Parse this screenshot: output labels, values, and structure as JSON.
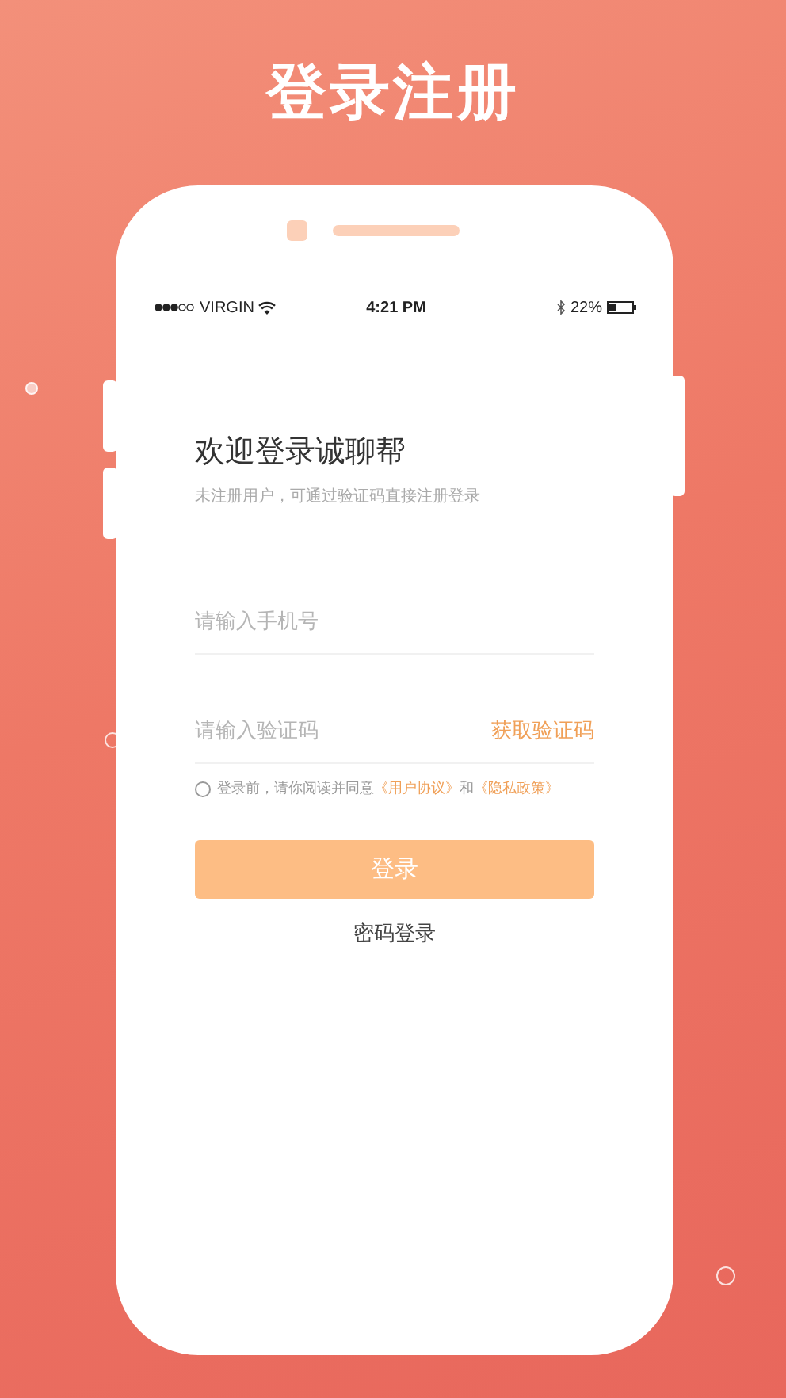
{
  "headline": "登录注册",
  "status_bar": {
    "carrier": "VIRGIN",
    "time": "4:21 PM",
    "battery": "22%"
  },
  "login": {
    "title": "欢迎登录诚聊帮",
    "subtitle": "未注册用户，可通过验证码直接注册登录",
    "phone_field": {
      "placeholder": "请输入手机号"
    },
    "code_field": {
      "placeholder": "请输入验证码"
    },
    "get_code": "获取验证码",
    "agreement": {
      "checked": false,
      "text": "登录前，请你阅读并同意",
      "links": [
        "《用户协议》",
        "《隐私政策》"
      ],
      "joiner": "和"
    },
    "login_button": "登录",
    "password_login": "密码登录"
  }
}
